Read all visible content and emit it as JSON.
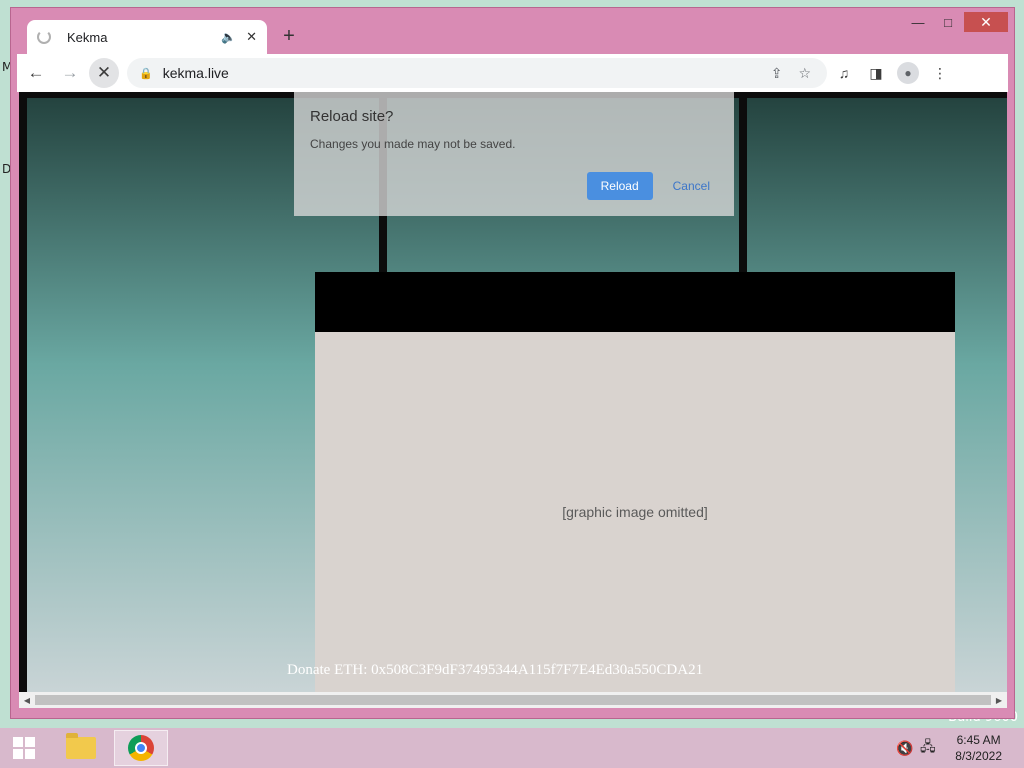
{
  "desktop": {
    "fragments": [
      "M",
      "D"
    ],
    "build_text": "Build 9600"
  },
  "browser": {
    "tab": {
      "title": "Kekma",
      "audio_icon": "speaker-icon",
      "close_icon": "close-icon"
    },
    "new_tab_label": "+",
    "window_controls": {
      "minimize": "—",
      "maximize": "□",
      "close": "✕"
    },
    "url": "kekma.live",
    "icons": [
      "back-icon",
      "forward-icon",
      "stop-icon",
      "lock-icon",
      "share-icon",
      "star-icon",
      "media-icon",
      "sidepanel-icon",
      "profile-icon",
      "menu-icon"
    ]
  },
  "dialog": {
    "title": "Reload site?",
    "message": "Changes you made may not be saved.",
    "reload_label": "Reload",
    "cancel_label": "Cancel"
  },
  "page": {
    "donate_text": "Donate ETH: 0x508C3F9dF37495344A115f7F7E4Ed30a550CDA21",
    "image_placeholder": "[graphic image omitted]"
  },
  "taskbar": {
    "time": "6:45 AM",
    "date": "8/3/2022",
    "apps": [
      "file-explorer",
      "chrome"
    ]
  },
  "colors": {
    "window_frame": "#d98bb4",
    "taskbar": "#d8b9cc",
    "dialog_button": "#4a8fe0"
  }
}
